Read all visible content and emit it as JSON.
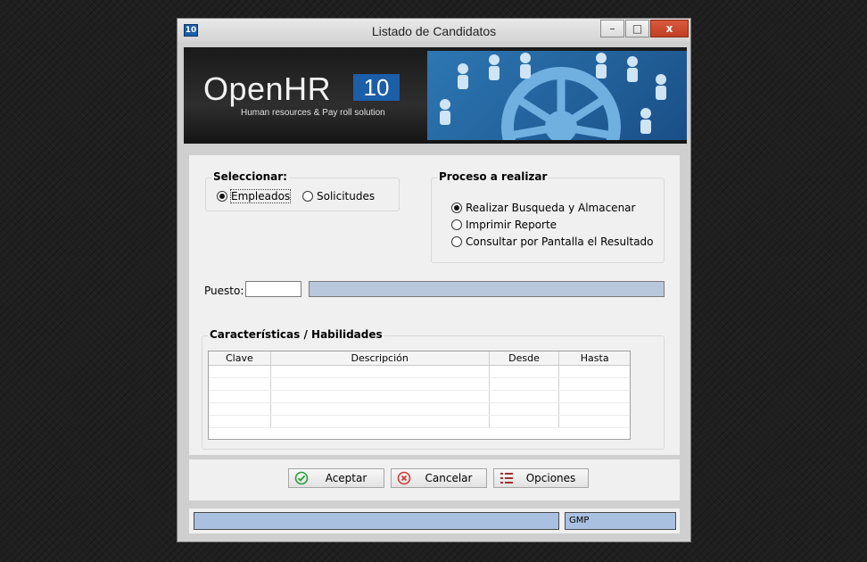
{
  "window": {
    "title": "Listado de Candidatos",
    "icon_label": "10",
    "controls": {
      "minimize": "–",
      "maximize": "□",
      "close": "x"
    }
  },
  "banner": {
    "logo_text": "OpenHR",
    "logo_number": "10",
    "tagline": "Human resources & Pay roll solution"
  },
  "seleccionar": {
    "title": "Seleccionar:",
    "options": [
      {
        "label": "Empleados",
        "selected": true
      },
      {
        "label": "Solicitudes",
        "selected": false
      }
    ]
  },
  "proceso": {
    "title": "Proceso a realizar",
    "options": [
      {
        "label": "Realizar Busqueda y Almacenar",
        "selected": true
      },
      {
        "label": "Imprimir Reporte",
        "selected": false
      },
      {
        "label": "Consultar por Pantalla el Resultado",
        "selected": false
      }
    ]
  },
  "puesto": {
    "label": "Puesto:",
    "code_value": "",
    "description_value": ""
  },
  "caracteristicas": {
    "title": "Características / Habilidades",
    "columns": [
      "Clave",
      "Descripción",
      "Desde",
      "Hasta"
    ],
    "rows": []
  },
  "buttons": {
    "accept": "Aceptar",
    "cancel": "Cancelar",
    "options": "Opciones"
  },
  "status": {
    "main": "",
    "gmp": "GMP"
  },
  "colors": {
    "accent_blue": "#1c5ea8",
    "status_fill": "#a9c0e0",
    "close_red": "#c23f22"
  }
}
